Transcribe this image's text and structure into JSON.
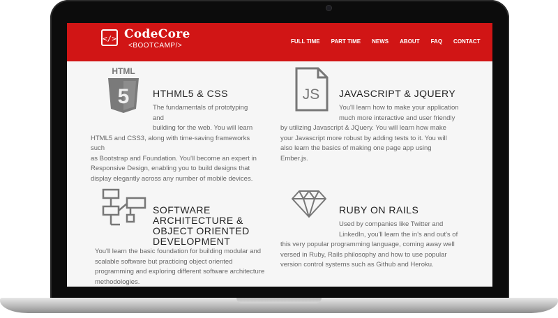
{
  "brand": {
    "name": "CodeCore",
    "sub": "<BOOTCAMP/>",
    "logo_glyph": "</>"
  },
  "nav": [
    "FULL TIME",
    "PART TIME",
    "NEWS",
    "ABOUT",
    "FAQ",
    "CONTACT"
  ],
  "colors": {
    "accent": "#d11515",
    "bezel": "#0c0c0c",
    "icon": "#777777"
  },
  "sections": [
    {
      "icon": "html5-icon",
      "icon_label": "HTML",
      "icon_glyph": "5",
      "title": "HTHML5 & CSS",
      "lines": [
        "The fundamentals of prototyping and",
        "building for the web. You will learn",
        "HTML5 and CSS3, along with time-saving frameworks such",
        "as Bootstrap and Foundation. You'll become an expert in",
        "Responsive Design, enabling you to build designs that",
        "display elegantly across any number of mobile devices."
      ]
    },
    {
      "icon": "javascript-file-icon",
      "icon_glyph": "JS",
      "title": "JAVASCRIPT & JQUERY",
      "lines": [
        "You'll learn how to make your application",
        "much more interactive and user friendly",
        "by utilizing Javascript & JQuery. You will learn how make",
        "your Javascript more robust by adding tests to it. You will",
        "also learn the basics of making one page app using",
        "Ember.js."
      ]
    },
    {
      "icon": "flowchart-icon",
      "title_lines": [
        "SOFTWARE",
        "ARCHITECTURE &",
        "OBJECT ORIENTED",
        "DEVELOPMENT"
      ],
      "lines": [
        "You'll learn the basic foundation for building modular and",
        "scalable software but practicing object oriented",
        "programming and exploring different software architecture",
        "methodologies."
      ]
    },
    {
      "icon": "ruby-gem-icon",
      "title": "RUBY ON RAILS",
      "lines": [
        "Used by companies like Twitter and",
        "LinkedIn, you'll learn the in's and out's of",
        "this very popular programming language, coming away well",
        "versed in Ruby, Rails philosophy and how to use popular",
        "version control systems such as Github and Heroku."
      ]
    }
  ]
}
